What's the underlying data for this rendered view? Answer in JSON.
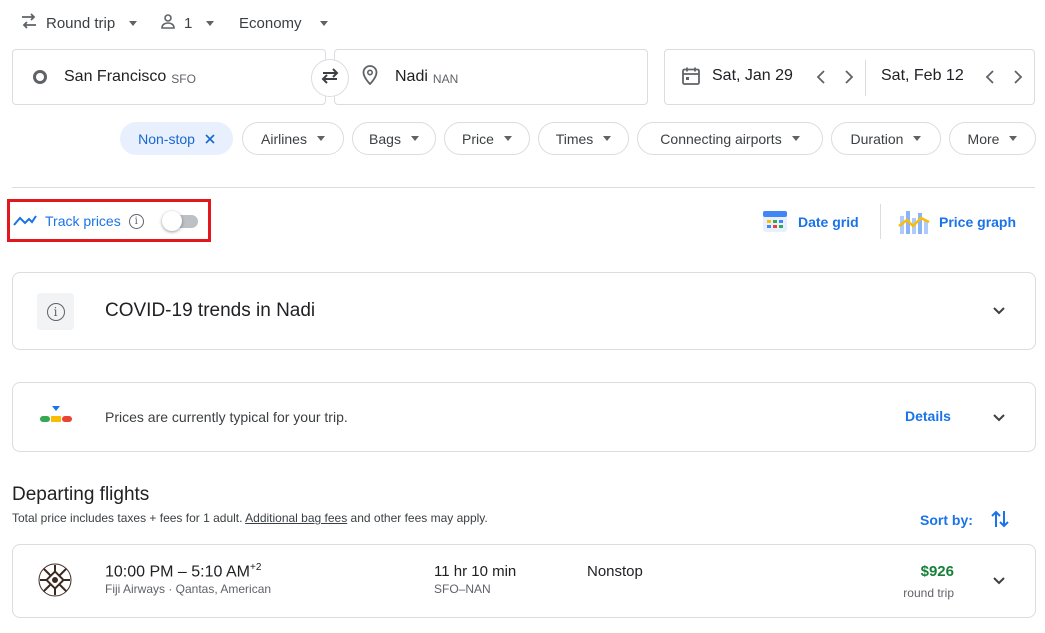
{
  "top_bar": {
    "trip_type": "Round trip",
    "passengers": "1",
    "cabin_class": "Economy"
  },
  "search": {
    "origin_city": "San Francisco",
    "origin_code": "SFO",
    "destination_city": "Nadi",
    "destination_code": "NAN",
    "depart_date": "Sat, Jan 29",
    "return_date": "Sat, Feb 12"
  },
  "filters": {
    "active_chip": "Non-stop",
    "chips": [
      "Airlines",
      "Bags",
      "Price",
      "Times",
      "Connecting airports",
      "Duration",
      "More"
    ]
  },
  "tools": {
    "track_prices_label": "Track prices",
    "track_prices_enabled": false,
    "date_grid_label": "Date grid",
    "price_graph_label": "Price graph"
  },
  "covid_card": {
    "title": "COVID-19 trends in Nadi"
  },
  "price_insight": {
    "text": "Prices are currently typical for your trip.",
    "details_label": "Details"
  },
  "departing": {
    "title": "Departing flights",
    "note_prefix": "Total price includes taxes + fees for 1 adult. ",
    "note_link": "Additional bag fees",
    "note_suffix": " and other fees may apply.",
    "sort_label": "Sort by:"
  },
  "flights": [
    {
      "times": "10:00 PM – 5:10 AM",
      "day_offset": "+2",
      "airlines": "Fiji Airways · Qantas, American",
      "duration": "11 hr 10 min",
      "route": "SFO–NAN",
      "stops": "Nonstop",
      "price": "$926",
      "price_note": "round trip"
    }
  ],
  "colors": {
    "accent_blue": "#1a73e8",
    "price_green": "#188038",
    "highlight_red": "#e3171e",
    "chip_active_bg": "#e8f0fe"
  }
}
